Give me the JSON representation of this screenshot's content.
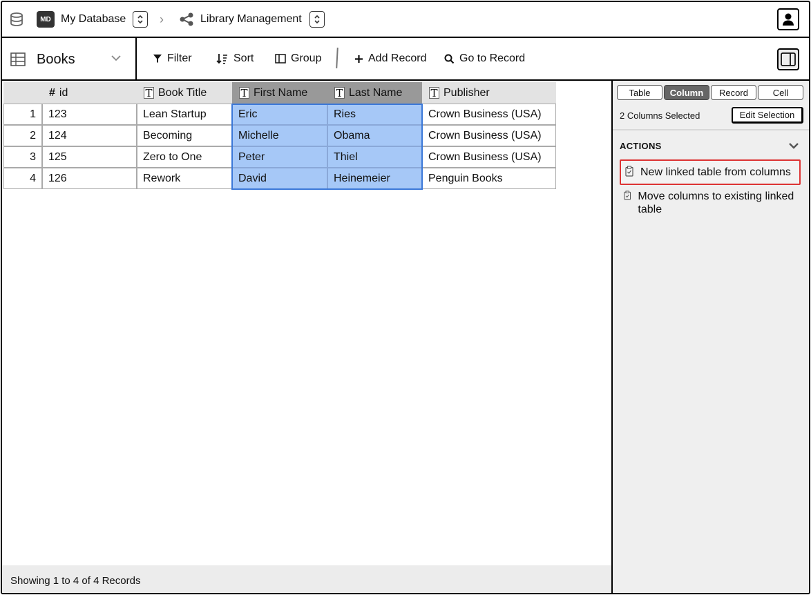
{
  "topbar": {
    "db_badge": "MD",
    "db_name": "My Database",
    "library_name": "Library Management"
  },
  "toolbar": {
    "table_name": "Books",
    "filter": "Filter",
    "sort": "Sort",
    "group": "Group",
    "add_record": "Add Record",
    "go_to_record": "Go to Record"
  },
  "table": {
    "columns": [
      {
        "glyph": "#",
        "label": "id",
        "selected": false
      },
      {
        "glyph": "T",
        "label": "Book Title",
        "selected": false
      },
      {
        "glyph": "T",
        "label": "First Name",
        "selected": true
      },
      {
        "glyph": "T",
        "label": "Last Name",
        "selected": true
      },
      {
        "glyph": "T",
        "label": "Publisher",
        "selected": false
      }
    ],
    "rows": [
      {
        "num": "1",
        "cells": [
          "123",
          "Lean Startup",
          "Eric",
          "Ries",
          "Crown Business (USA)"
        ]
      },
      {
        "num": "2",
        "cells": [
          "124",
          "Becoming",
          "Michelle",
          "Obama",
          "Crown Business (USA)"
        ]
      },
      {
        "num": "3",
        "cells": [
          "125",
          "Zero to One",
          "Peter",
          "Thiel",
          "Crown Business (USA)"
        ]
      },
      {
        "num": "4",
        "cells": [
          "126",
          "Rework",
          "David",
          "Heinemeier",
          "Penguin Books"
        ]
      }
    ],
    "footer": "Showing 1 to 4 of 4 Records"
  },
  "panel": {
    "tabs": [
      {
        "label": "Table",
        "active": false
      },
      {
        "label": "Column",
        "active": true
      },
      {
        "label": "Record",
        "active": false
      },
      {
        "label": "Cell",
        "active": false
      }
    ],
    "selection_count": "2 Columns Selected",
    "edit_selection": "Edit Selection",
    "actions_title": "ACTIONS",
    "actions": [
      {
        "label": "New linked table from columns",
        "highlighted": true
      },
      {
        "label": "Move columns to existing linked table",
        "highlighted": false
      }
    ]
  },
  "colors": {
    "selected_cell": "#a6c8f7",
    "selected_outline": "#3b78d8",
    "selected_header": "#999999",
    "highlight_border": "#dd3333"
  },
  "icons": {
    "db": "database-icon",
    "share": "share-nodes-icon",
    "user": "user-icon",
    "grid": "table-grid-icon",
    "filter": "filter-icon",
    "sort": "sort-icon",
    "group": "group-columns-icon",
    "add": "plus-icon",
    "search": "search-icon",
    "panel": "sidebar-panel-icon",
    "clipboard": "clipboard-icon"
  }
}
